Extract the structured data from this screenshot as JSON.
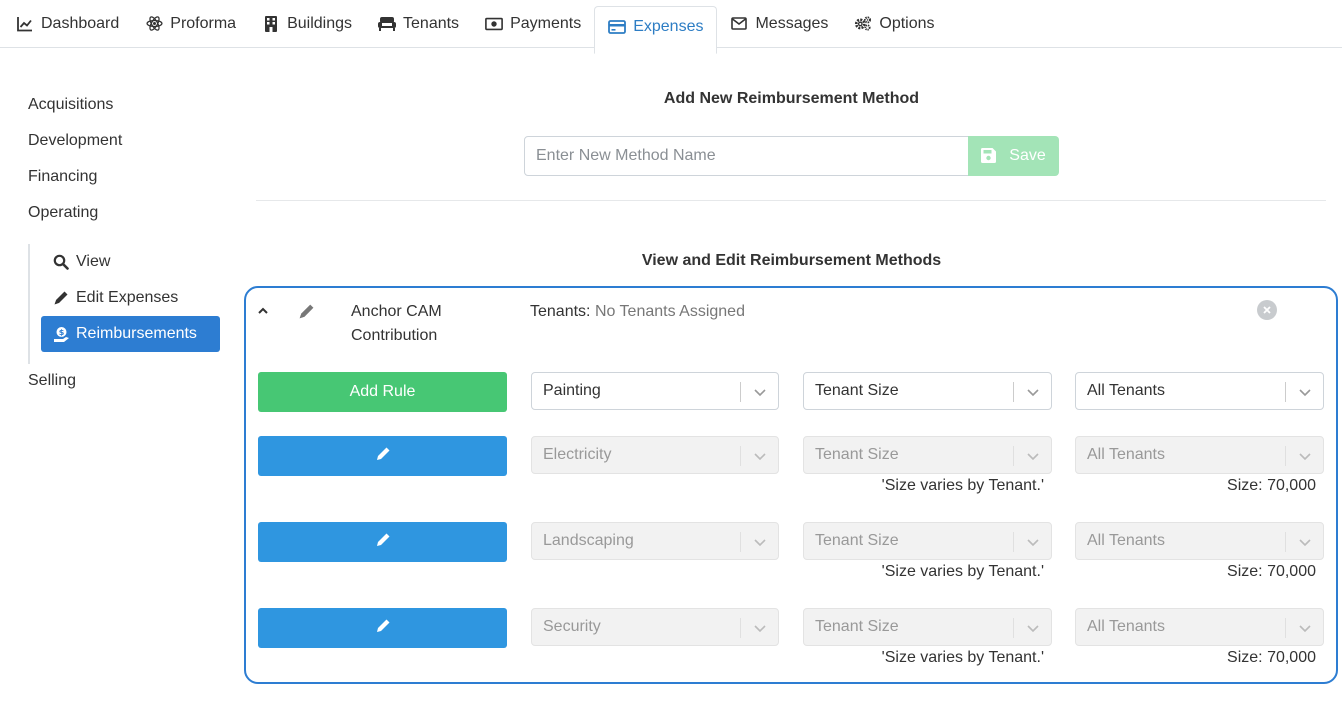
{
  "tabs": [
    {
      "label": "Dashboard",
      "icon": "chart-line-icon"
    },
    {
      "label": "Proforma",
      "icon": "atom-icon"
    },
    {
      "label": "Buildings",
      "icon": "building-icon"
    },
    {
      "label": "Tenants",
      "icon": "couch-icon"
    },
    {
      "label": "Payments",
      "icon": "money-bill-icon"
    },
    {
      "label": "Expenses",
      "icon": "credit-card-icon",
      "active": true
    },
    {
      "label": "Messages",
      "icon": "envelope-icon"
    },
    {
      "label": "Options",
      "icon": "cogs-icon"
    }
  ],
  "sidebar": {
    "items": [
      "Acquisitions",
      "Development",
      "Financing",
      "Operating",
      "Selling"
    ],
    "subitems": [
      {
        "label": "View",
        "icon": "search-icon"
      },
      {
        "label": "Edit Expenses",
        "icon": "pencil-icon"
      },
      {
        "label": "Reimbursements",
        "icon": "money-hand-icon",
        "active": true
      }
    ]
  },
  "add_section": {
    "title": "Add New Reimbursement Method",
    "placeholder": "Enter New Method Name",
    "save_label": "Save"
  },
  "edit_section": {
    "title": "View and Edit Reimbursement Methods"
  },
  "method": {
    "name": "Anchor CAM Contribution",
    "tenants_label": "Tenants:",
    "tenants_value": "No Tenants Assigned",
    "add_rule_label": "Add Rule",
    "new_rule": {
      "expense": "Painting",
      "basis": "Tenant Size",
      "tenants": "All Tenants"
    },
    "rules": [
      {
        "expense": "Electricity",
        "basis": "Tenant Size",
        "tenants": "All Tenants",
        "basis_note": "'Size varies by Tenant.'",
        "size_note": "Size: 70,000"
      },
      {
        "expense": "Landscaping",
        "basis": "Tenant Size",
        "tenants": "All Tenants",
        "basis_note": "'Size varies by Tenant.'",
        "size_note": "Size: 70,000"
      },
      {
        "expense": "Security",
        "basis": "Tenant Size",
        "tenants": "All Tenants",
        "basis_note": "'Size varies by Tenant.'",
        "size_note": "Size: 70,000"
      }
    ]
  },
  "colors": {
    "accent": "#2d7dd2",
    "green": "#47c774",
    "save_disabled": "#a3e4b7",
    "edit_button": "#2f96e0"
  }
}
